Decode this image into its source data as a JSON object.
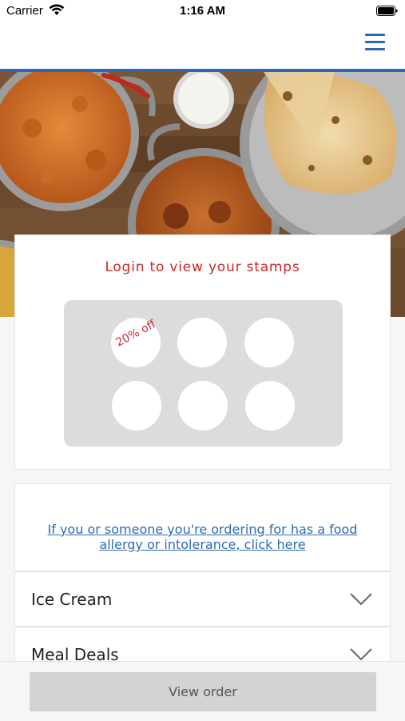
{
  "status_bar": {
    "carrier": "Carrier",
    "time": "1:16 AM"
  },
  "header": {
    "menu_icon": "hamburger-menu-icon",
    "accent_color": "#2f67b2"
  },
  "hero": {
    "image": "indian-curry-and-naan-photo"
  },
  "stamp_card": {
    "title": "Login to view your stamps",
    "title_color": "#c8282a",
    "reward_label": "20% off",
    "stamps_total": 6
  },
  "allergy": {
    "link_text": "If you or someone you're ordering for has a food allergy or intolerance, click here"
  },
  "categories": [
    {
      "label": "Ice Cream",
      "icon": "chevron-down-icon"
    },
    {
      "label": "Meal Deals",
      "icon": "chevron-down-icon"
    }
  ],
  "footer": {
    "view_order_label": "View order"
  }
}
